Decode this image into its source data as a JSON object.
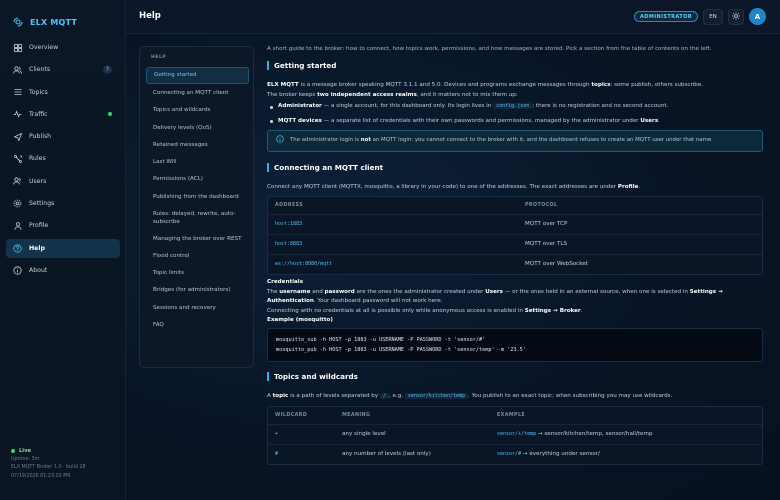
{
  "app": {
    "name": "ELX MQTT",
    "page_title": "Help",
    "role_badge": "ADMINISTRATOR",
    "language": "EN",
    "avatar_letter": "A",
    "accent": "#4fc3f7"
  },
  "sidebar": {
    "items": [
      {
        "label": "Overview",
        "icon": "grid-icon"
      },
      {
        "label": "Clients",
        "icon": "users-icon",
        "badge": "7"
      },
      {
        "label": "Topics",
        "icon": "list-icon"
      },
      {
        "label": "Traffic",
        "icon": "activity-icon",
        "status": "online"
      },
      {
        "label": "Publish",
        "icon": "send-icon"
      },
      {
        "label": "Rules",
        "icon": "rules-icon"
      },
      {
        "label": "Users",
        "icon": "user-group-icon"
      },
      {
        "label": "Settings",
        "icon": "gear-icon"
      },
      {
        "label": "Profile",
        "icon": "person-icon"
      },
      {
        "label": "Help",
        "icon": "help-icon",
        "active": true
      },
      {
        "label": "About",
        "icon": "info-icon"
      }
    ],
    "footer": {
      "status": "Live",
      "uptime": "Uptime: 3m",
      "build": "ELX MQTT Broker 1.0 · build 28",
      "timestamp": "07/19/2026 01:23:03 PM"
    }
  },
  "toc": {
    "heading": "HELP",
    "items": [
      "Getting started",
      "Connecting an MQTT client",
      "Topics and wildcards",
      "Delivery levels (QoS)",
      "Retained messages",
      "Last Will",
      "Permissions (ACL)",
      "Publishing from the dashboard",
      "Rules: delayed, rewrite, auto-subscribe",
      "Managing the broker over REST",
      "Flood control",
      "Topic limits",
      "Bridges (for administrators)",
      "Sessions and recovery",
      "FAQ"
    ]
  },
  "content": {
    "lead": "A short guide to the broker: how to connect, how topics work, permissions, and how messages are stored. Pick a section from the table of contents on the left.",
    "getting_started": {
      "title": "Getting started",
      "p1_brand": "ELX MQTT",
      "p1_a": " is a message broker speaking MQTT 3.1.1 and 5.0. Devices and programs exchange messages through ",
      "p1_topics": "topics",
      "p1_b": ": some publish, others subscribe.",
      "p2_a": "The broker keeps ",
      "p2_b": "two independent access realms",
      "p2_c": ", and it matters not to mix them up:",
      "b1_a": "Administrator",
      "b1_b": " — a single account, for this dashboard only. Its login lives in ",
      "b1_code": "config.json",
      "b1_c": "; there is no registration and no second account.",
      "b2_a": "MQTT devices",
      "b2_b": " — a separate list of credentials with their own passwords and permissions, managed by the administrator under ",
      "b2_c": "Users",
      "b2_d": ".",
      "note_a": "The administrator login is ",
      "note_b": "not",
      "note_c": " an MQTT login: you cannot connect to the broker with it, and the dashboard refuses to create an MQTT user under that name."
    },
    "connecting": {
      "title": "Connecting an MQTT client",
      "intro_a": "Connect any MQTT client (MQTTX, mosquitto, a library in your code) to one of the addresses. The exact addresses are under ",
      "intro_b": "Profile",
      "intro_c": ".",
      "columns": [
        "ADDRESS",
        "PROTOCOL"
      ],
      "rows": [
        {
          "address": "host:1883",
          "protocol": "MQTT over TCP"
        },
        {
          "address": "host:8883",
          "protocol": "MQTT over TLS"
        },
        {
          "address": "ws://host:8080/mqtt",
          "protocol": "MQTT over WebSocket"
        }
      ],
      "cred_title": "Credentials",
      "cred1_a": "The ",
      "cred1_b": "username",
      "cred1_c": " and ",
      "cred1_d": "password",
      "cred1_e": " are the ones the administrator created under ",
      "cred1_f": "Users",
      "cred1_g": " — or the ones held in an external source, when one is selected in ",
      "cred1_h": "Settings →",
      "cred2_a": "Authentication",
      "cred2_b": ". Your dashboard password will not work here.",
      "cred3_a": "Connecting with no credentials at all is possible only while anonymous access is enabled in ",
      "cred3_b": "Settings → Broker",
      "cred3_c": ".",
      "example_title": "Example (mosquitto)",
      "code_line1": "mosquitto_sub -h HOST -p 1883 -u USERNAME -P PASSWORD -t 'sensor/#'",
      "code_line2": "mosquitto_pub -h HOST -p 1883 -u USERNAME -P PASSWORD -t 'sensor/temp' -m '23.5'"
    },
    "topics": {
      "title": "Topics and wildcards",
      "intro_a": "A ",
      "intro_b": "topic",
      "intro_c": " is a path of levels separated by ",
      "intro_code1": "/",
      "intro_d": ", e.g. ",
      "intro_code2": "sensor/kitchen/temp",
      "intro_e": ". You publish to an exact topic; when subscribing you may use wildcards.",
      "columns": [
        "WILDCARD",
        "MEANING",
        "EXAMPLE"
      ],
      "rows": [
        {
          "wildcard": "+",
          "meaning": "any single level",
          "example_code": "sensor/+/temp",
          "example_text": " → sensor/kitchen/temp, sensor/hall/temp"
        },
        {
          "wildcard": "#",
          "meaning": "any number of levels (last only)",
          "example_code": "sensor/#",
          "example_text": " → everything under sensor/"
        }
      ]
    }
  }
}
